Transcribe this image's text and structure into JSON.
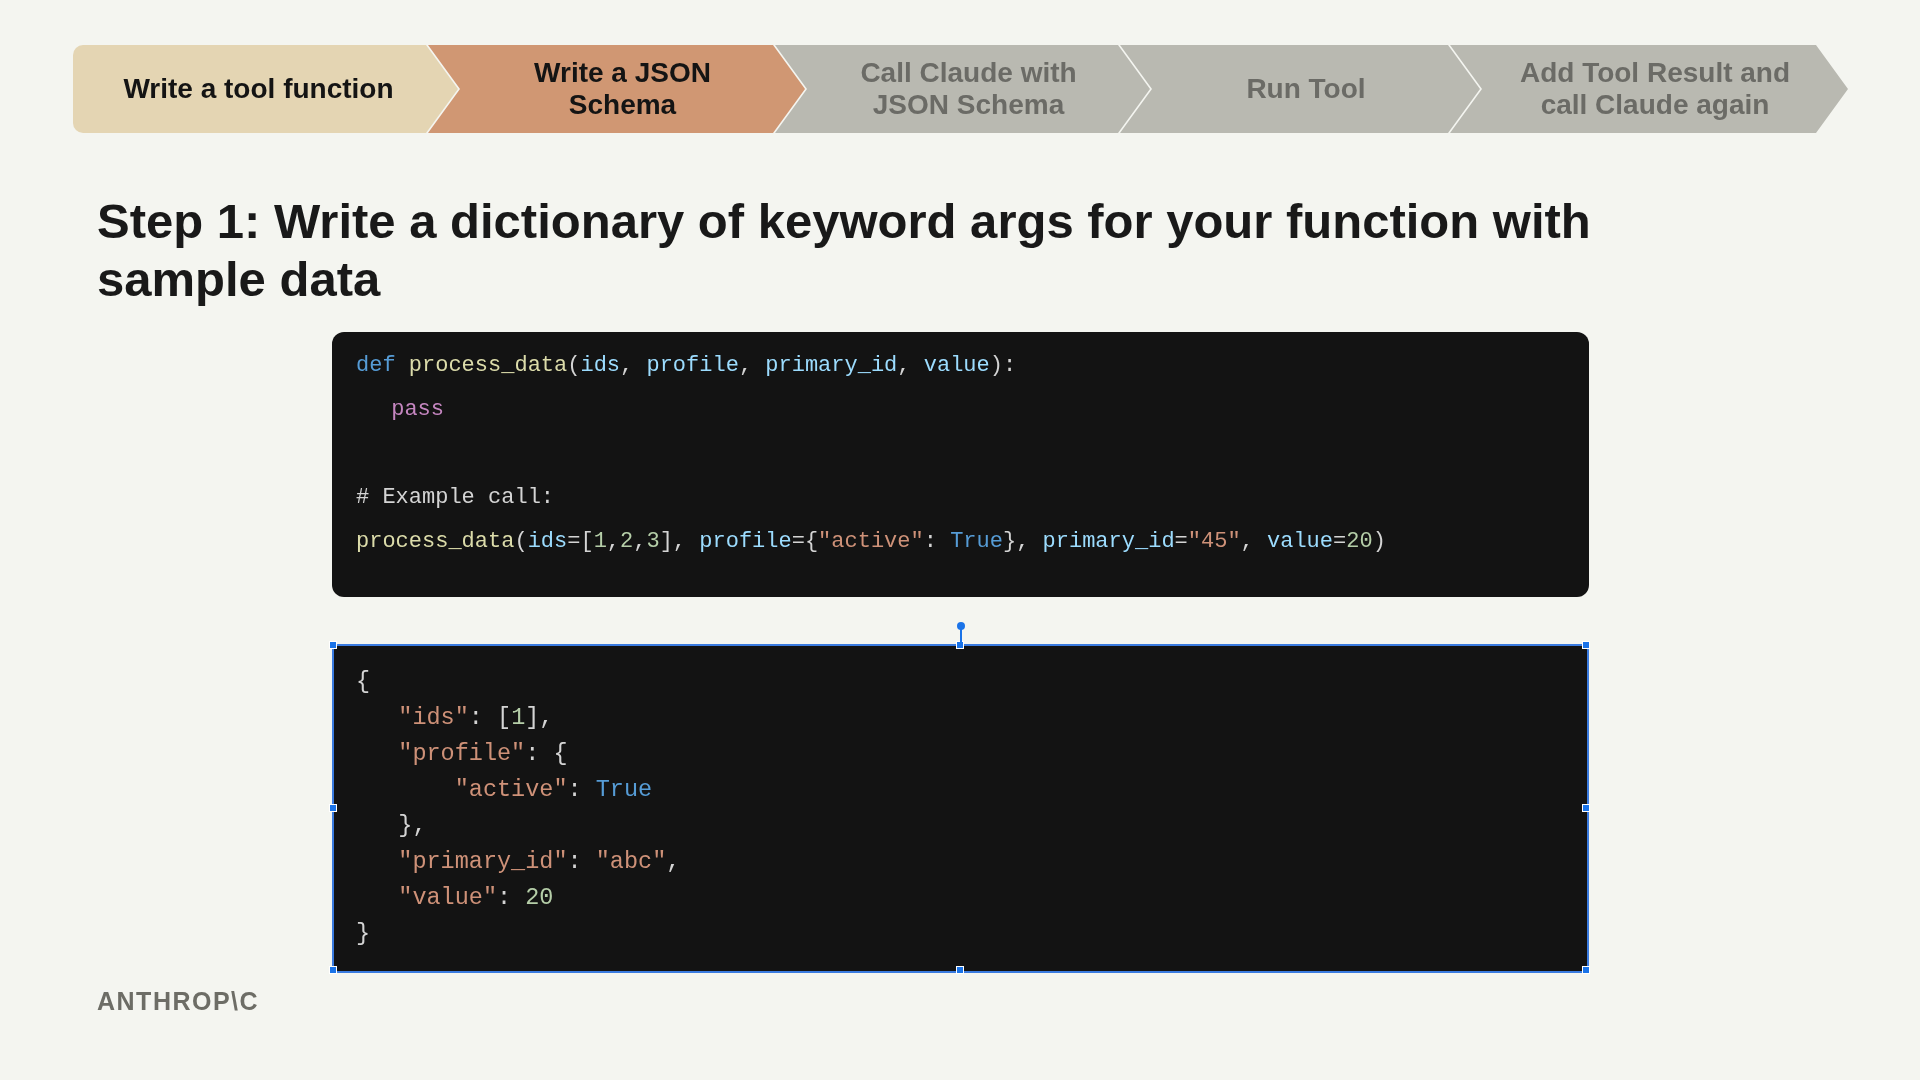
{
  "steps": [
    {
      "label": "Write a tool function",
      "completed": true,
      "selected": false
    },
    {
      "label": "Write a JSON Schema",
      "completed": false,
      "selected": true
    },
    {
      "label": "Call Claude with JSON Schema",
      "completed": false,
      "selected": false
    },
    {
      "label": "Run Tool",
      "completed": false,
      "selected": false
    },
    {
      "label": "Add Tool Result and call Claude again",
      "completed": false,
      "selected": false
    }
  ],
  "heading": "Step 1: Write a dictionary of keyword args for your function with sample data",
  "code_blocks": [
    {
      "selected": false,
      "lines": [
        {
          "tokens": [
            {
              "kind": "keyword",
              "text": "def "
            },
            {
              "kind": "func",
              "text": "process_data"
            },
            {
              "kind": "plain",
              "text": "("
            },
            {
              "kind": "param",
              "text": "ids"
            },
            {
              "kind": "plain",
              "text": ", "
            },
            {
              "kind": "param",
              "text": "profile"
            },
            {
              "kind": "plain",
              "text": ", "
            },
            {
              "kind": "param",
              "text": "primary_id"
            },
            {
              "kind": "plain",
              "text": ", "
            },
            {
              "kind": "param",
              "text": "value"
            },
            {
              "kind": "plain",
              "text": "):"
            }
          ],
          "children": [
            {
              "tokens": [
                {
                  "kind": "control",
                  "text": "pass"
                }
              ]
            }
          ]
        },
        {
          "tokens": [
            {
              "kind": "comment",
              "text": "# Example call:"
            }
          ]
        },
        {
          "tokens": [
            {
              "kind": "func",
              "text": "process_data"
            },
            {
              "kind": "plain",
              "text": "("
            },
            {
              "kind": "param",
              "text": "ids"
            },
            {
              "kind": "plain",
              "text": "=["
            },
            {
              "kind": "number",
              "text": "1"
            },
            {
              "kind": "plain",
              "text": ","
            },
            {
              "kind": "number",
              "text": "2"
            },
            {
              "kind": "plain",
              "text": ","
            },
            {
              "kind": "number",
              "text": "3"
            },
            {
              "kind": "plain",
              "text": "], "
            },
            {
              "kind": "param",
              "text": "profile"
            },
            {
              "kind": "plain",
              "text": "={"
            },
            {
              "kind": "string",
              "text": "\"active\""
            },
            {
              "kind": "plain",
              "text": ": "
            },
            {
              "kind": "keyword",
              "text": "True"
            },
            {
              "kind": "plain",
              "text": "}, "
            },
            {
              "kind": "param",
              "text": "primary_id"
            },
            {
              "kind": "plain",
              "text": "="
            },
            {
              "kind": "string",
              "text": "\"45\""
            },
            {
              "kind": "plain",
              "text": ", "
            },
            {
              "kind": "param",
              "text": "value"
            },
            {
              "kind": "plain",
              "text": "="
            },
            {
              "kind": "number",
              "text": "20"
            },
            {
              "kind": "plain",
              "text": ")"
            }
          ]
        }
      ]
    },
    {
      "selected": true,
      "lines": [
        {
          "tokens": [
            {
              "kind": "plain",
              "text": "{"
            }
          ],
          "children": [
            {
              "tokens": [
                {
                  "kind": "string",
                  "text": "\"ids\""
                },
                {
                  "kind": "plain",
                  "text": ": ["
                },
                {
                  "kind": "number",
                  "text": "1"
                },
                {
                  "kind": "plain",
                  "text": "],"
                }
              ]
            },
            {
              "tokens": [
                {
                  "kind": "string",
                  "text": "\"profile\""
                },
                {
                  "kind": "plain",
                  "text": ": {"
                }
              ],
              "children": [
                {
                  "tokens": [
                    {
                      "kind": "string",
                      "text": "\"active\""
                    },
                    {
                      "kind": "plain",
                      "text": ": "
                    },
                    {
                      "kind": "keyword",
                      "text": "True"
                    }
                  ]
                }
              ]
            },
            {
              "tokens": [
                {
                  "kind": "plain",
                  "text": "},"
                }
              ]
            },
            {
              "tokens": [
                {
                  "kind": "string",
                  "text": "\"primary_id\""
                },
                {
                  "kind": "plain",
                  "text": ": "
                },
                {
                  "kind": "string",
                  "text": "\"abc\""
                },
                {
                  "kind": "plain",
                  "text": ","
                }
              ]
            },
            {
              "tokens": [
                {
                  "kind": "string",
                  "text": "\"value\""
                },
                {
                  "kind": "plain",
                  "text": ": "
                },
                {
                  "kind": "number",
                  "text": "20"
                }
              ]
            }
          ]
        },
        {
          "tokens": [
            {
              "kind": "plain",
              "text": "}"
            }
          ]
        }
      ]
    }
  ],
  "logo": "ANTHROP\\C"
}
